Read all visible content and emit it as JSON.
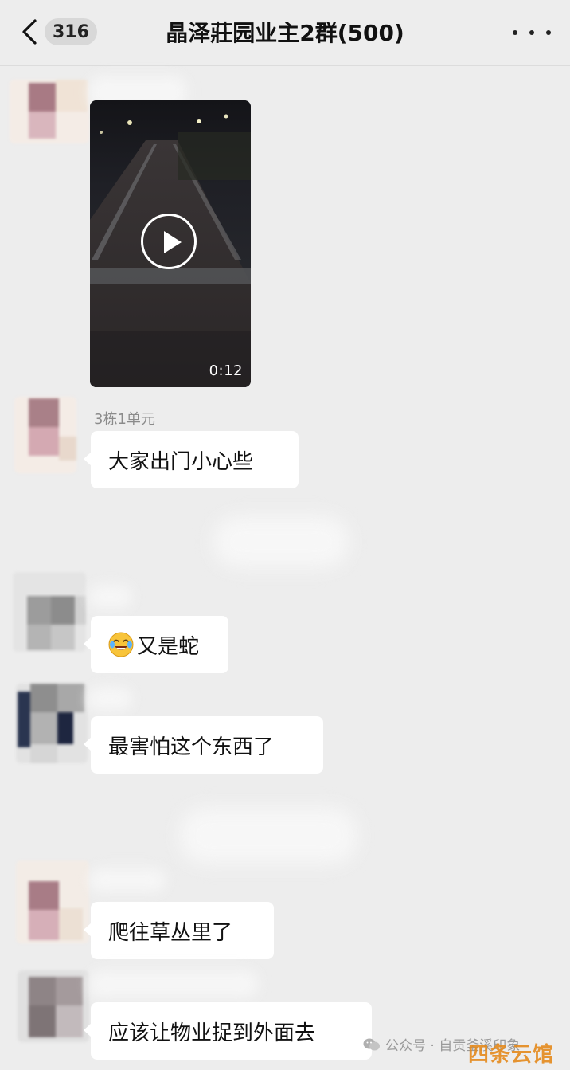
{
  "header": {
    "unread_count": "316",
    "title": "晶泽莊园业主2群(500)"
  },
  "video": {
    "duration": "0:12"
  },
  "messages": [
    {
      "sender": "3栋1单元",
      "text": "大家出门小心些"
    },
    {
      "sender": "",
      "emoji": "crying-laughing-face-icon",
      "text": "又是蛇"
    },
    {
      "sender": "",
      "text": "最害怕这个东西了"
    },
    {
      "sender": "",
      "text": "爬往草丛里了"
    },
    {
      "sender": "",
      "text": "应该让物业捉到外面去"
    }
  ],
  "watermark": {
    "text": "公众号 · 自贡釜溪印象",
    "logo": "四条云馆"
  },
  "colors": {
    "background": "#ededed",
    "bubble": "#ffffff",
    "watermark_logo": "#e58a1c"
  }
}
